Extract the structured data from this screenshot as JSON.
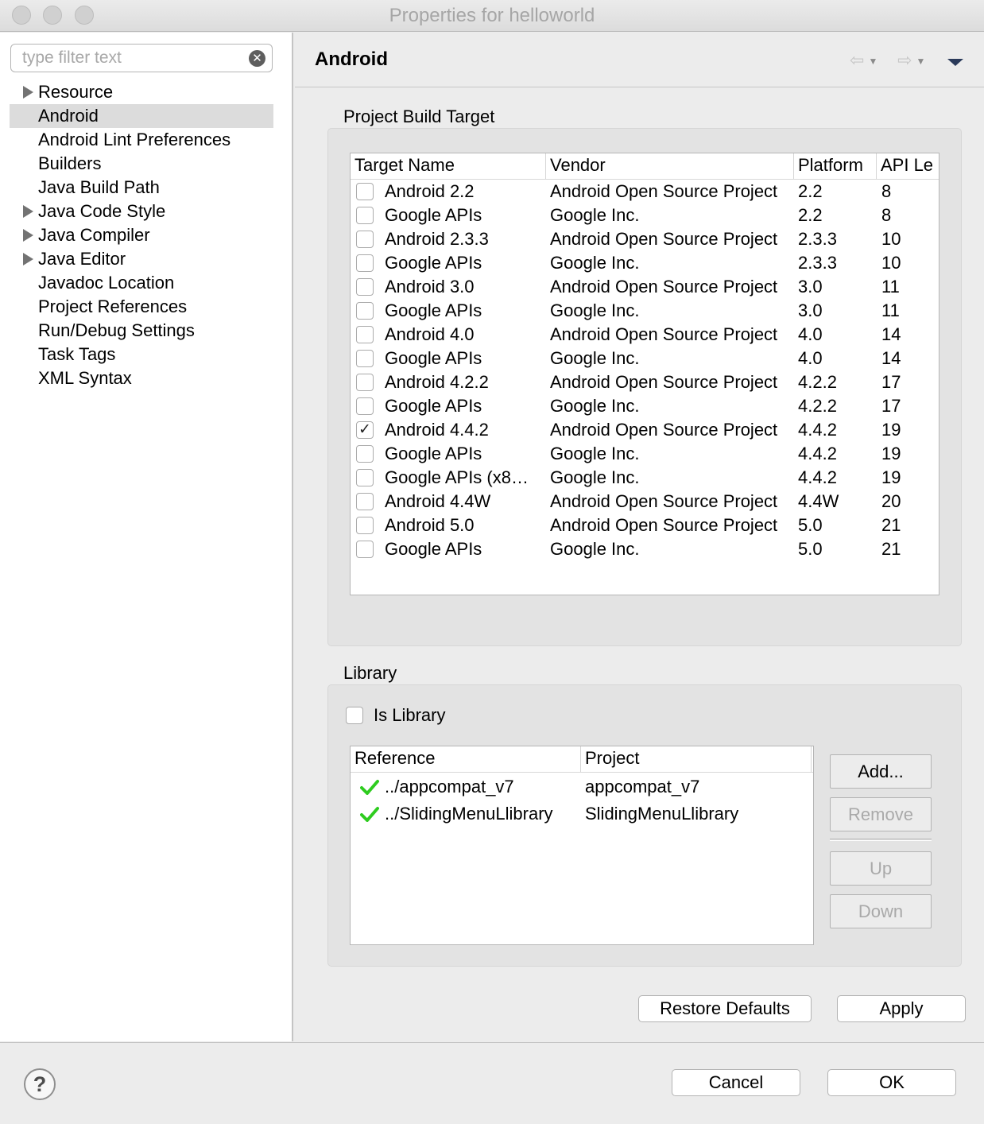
{
  "window": {
    "title": "Properties for helloworld"
  },
  "sidebar": {
    "filter_placeholder": "type filter text",
    "items": [
      {
        "label": "Resource",
        "expandable": true,
        "selected": false
      },
      {
        "label": "Android",
        "expandable": false,
        "selected": true
      },
      {
        "label": "Android Lint Preferences",
        "expandable": false,
        "selected": false
      },
      {
        "label": "Builders",
        "expandable": false,
        "selected": false
      },
      {
        "label": "Java Build Path",
        "expandable": false,
        "selected": false
      },
      {
        "label": "Java Code Style",
        "expandable": true,
        "selected": false
      },
      {
        "label": "Java Compiler",
        "expandable": true,
        "selected": false
      },
      {
        "label": "Java Editor",
        "expandable": true,
        "selected": false
      },
      {
        "label": "Javadoc Location",
        "expandable": false,
        "selected": false
      },
      {
        "label": "Project References",
        "expandable": false,
        "selected": false
      },
      {
        "label": "Run/Debug Settings",
        "expandable": false,
        "selected": false
      },
      {
        "label": "Task Tags",
        "expandable": false,
        "selected": false
      },
      {
        "label": "XML Syntax",
        "expandable": false,
        "selected": false
      }
    ]
  },
  "header": {
    "title": "Android",
    "back_glyph": "⇦",
    "forward_glyph": "⇨",
    "caret_glyph": "▼"
  },
  "build_target": {
    "group_label": "Project Build Target",
    "columns": [
      "Target Name",
      "Vendor",
      "Platform",
      "API Le"
    ],
    "rows": [
      {
        "checked": false,
        "name": "Android 2.2",
        "vendor": "Android Open Source Project",
        "platform": "2.2",
        "api": "8"
      },
      {
        "checked": false,
        "name": "Google APIs",
        "vendor": "Google Inc.",
        "platform": "2.2",
        "api": "8"
      },
      {
        "checked": false,
        "name": "Android 2.3.3",
        "vendor": "Android Open Source Project",
        "platform": "2.3.3",
        "api": "10"
      },
      {
        "checked": false,
        "name": "Google APIs",
        "vendor": "Google Inc.",
        "platform": "2.3.3",
        "api": "10"
      },
      {
        "checked": false,
        "name": "Android 3.0",
        "vendor": "Android Open Source Project",
        "platform": "3.0",
        "api": "11"
      },
      {
        "checked": false,
        "name": "Google APIs",
        "vendor": "Google Inc.",
        "platform": "3.0",
        "api": "11"
      },
      {
        "checked": false,
        "name": "Android 4.0",
        "vendor": "Android Open Source Project",
        "platform": "4.0",
        "api": "14"
      },
      {
        "checked": false,
        "name": "Google APIs",
        "vendor": "Google Inc.",
        "platform": "4.0",
        "api": "14"
      },
      {
        "checked": false,
        "name": "Android 4.2.2",
        "vendor": "Android Open Source Project",
        "platform": "4.2.2",
        "api": "17"
      },
      {
        "checked": false,
        "name": "Google APIs",
        "vendor": "Google Inc.",
        "platform": "4.2.2",
        "api": "17"
      },
      {
        "checked": true,
        "name": "Android 4.4.2",
        "vendor": "Android Open Source Project",
        "platform": "4.4.2",
        "api": "19"
      },
      {
        "checked": false,
        "name": "Google APIs",
        "vendor": "Google Inc.",
        "platform": "4.4.2",
        "api": "19"
      },
      {
        "checked": false,
        "name": "Google APIs (x8…",
        "vendor": "Google Inc.",
        "platform": "4.4.2",
        "api": "19"
      },
      {
        "checked": false,
        "name": "Android 4.4W",
        "vendor": "Android Open Source Project",
        "platform": "4.4W",
        "api": "20"
      },
      {
        "checked": false,
        "name": "Android 5.0",
        "vendor": "Android Open Source Project",
        "platform": "5.0",
        "api": "21"
      },
      {
        "checked": false,
        "name": "Google APIs",
        "vendor": "Google Inc.",
        "platform": "5.0",
        "api": "21"
      }
    ]
  },
  "library": {
    "group_label": "Library",
    "is_library_label": "Is Library",
    "is_library_checked": false,
    "columns": [
      "Reference",
      "Project"
    ],
    "rows": [
      {
        "reference": "../appcompat_v7",
        "project": "appcompat_v7",
        "icon": "green-check-icon"
      },
      {
        "reference": "../SlidingMenuLlibrary",
        "project": "SlidingMenuLlibrary",
        "icon": "green-check-icon"
      }
    ],
    "buttons": {
      "add": "Add...",
      "remove": "Remove",
      "up": "Up",
      "down": "Down"
    }
  },
  "page_buttons": {
    "restore_defaults": "Restore Defaults",
    "apply": "Apply"
  },
  "footer": {
    "help_glyph": "?",
    "cancel": "Cancel",
    "ok": "OK"
  },
  "colors": {
    "selection": "#dcdcdc",
    "check_green": "#2ecc1f",
    "group_bg": "#e3e3e3"
  }
}
